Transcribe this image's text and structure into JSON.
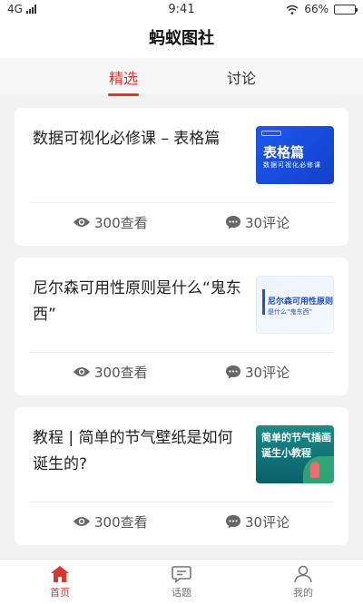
{
  "status_bar": {
    "network": "4G",
    "time": "9:41",
    "battery": "66%",
    "battery_level": 0.66
  },
  "header": {
    "title": "蚂蚁图社"
  },
  "tabs": [
    {
      "label": "精选",
      "active": true
    },
    {
      "label": "讨论",
      "active": false
    }
  ],
  "cards": [
    {
      "title": "数据可视化必修课 – 表格篇",
      "thumb": {
        "style": "blue",
        "line1": "表格篇",
        "line2": "数据可视化必修课"
      },
      "views": "300查看",
      "comments": "30评论"
    },
    {
      "title": "尼尔森可用性原则是什么“鬼东西”",
      "thumb": {
        "style": "light",
        "line1": "尼尔森可用性原则",
        "line2": "是什么“鬼东西”"
      },
      "views": "300查看",
      "comments": "30评论"
    },
    {
      "title": "教程 | 简单的节气壁纸是如何诞生的?",
      "thumb": {
        "style": "teal",
        "line1": "简单的节气插画",
        "line2": "诞生小教程"
      },
      "views": "300查看",
      "comments": "30评论"
    }
  ],
  "bottom_nav": [
    {
      "label": "首页",
      "icon": "home-icon",
      "active": true
    },
    {
      "label": "话题",
      "icon": "chat-icon",
      "active": false
    },
    {
      "label": "我的",
      "icon": "user-icon",
      "active": false
    }
  ],
  "colors": {
    "accent": "#e0322f",
    "thumb_blue": "#1d59f0",
    "thumb_teal": "#1a8c86"
  }
}
